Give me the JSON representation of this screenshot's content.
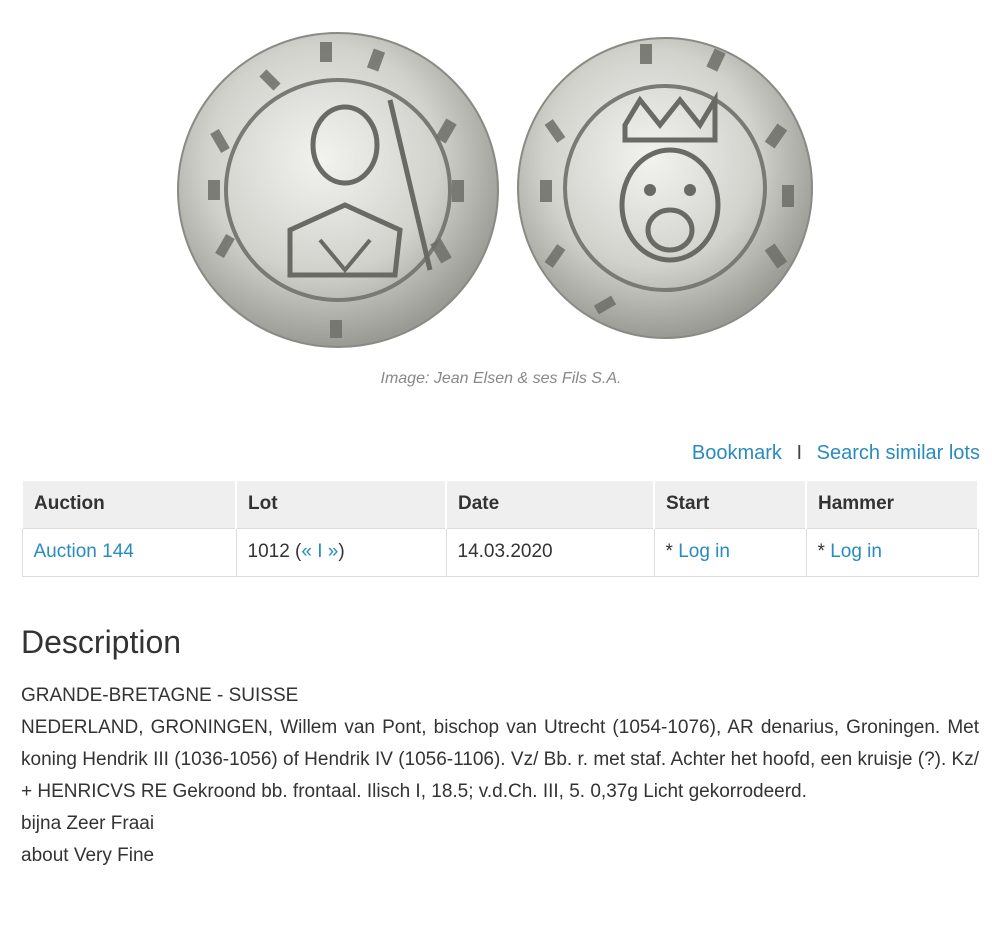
{
  "image": {
    "caption": "Image: Jean Elsen & ses Fils S.A."
  },
  "actions": {
    "bookmark": "Bookmark",
    "separator": "I",
    "search_similar": "Search similar lots"
  },
  "table": {
    "headers": [
      "Auction",
      "Lot",
      "Date",
      "Start",
      "Hammer"
    ],
    "row": {
      "auction": "Auction 144",
      "lot_number": "1012 (",
      "prev": "«",
      "divider": " I ",
      "next": "»",
      "lot_close": ")",
      "date": "14.03.2020",
      "start_prefix": "* ",
      "start_link": "Log in",
      "hammer_prefix": "* ",
      "hammer_link": "Log in"
    }
  },
  "description": {
    "title": "Description",
    "category": "GRANDE-BRETAGNE - SUISSE",
    "text": "NEDERLAND, GRONINGEN, Willem van Pont, bischop van Utrecht (1054-1076), AR denarius, Groningen. Met koning Hendrik III (1036-1056) of Hendrik IV (1056-1106). Vz/ Bb. r. met staf. Achter het hoofd, een kruisje (?). Kz/ + HENRICVS RE Gekroond bb. frontaal. Ilisch I, 18.5; v.d.Ch. III, 5. 0,37g Licht gekorrodeerd.",
    "grade_nl": "bijna Zeer Fraai",
    "grade_en": "about Very Fine"
  },
  "colors": {
    "link": "#2a8bc0",
    "header_bg": "#efefef",
    "coin_silver": "#d6d6d2"
  }
}
